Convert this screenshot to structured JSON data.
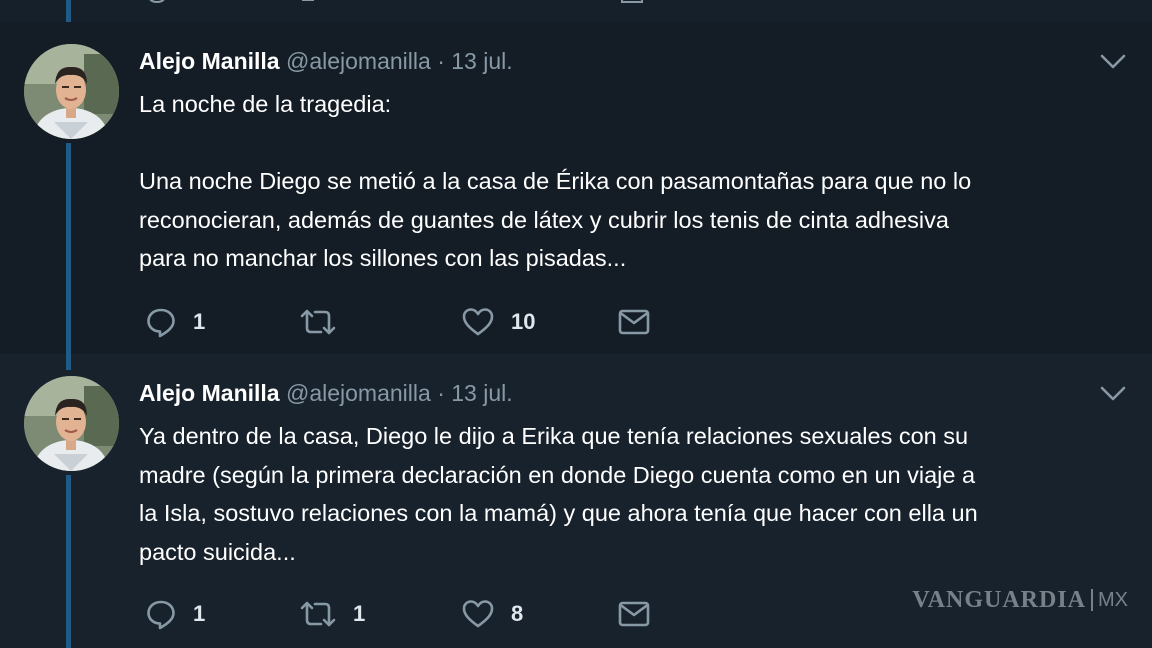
{
  "tweets": [
    {
      "author_name": "Alejo Manilla",
      "author_handle": "@alejomanilla",
      "separator": "·",
      "date": "13 jul.",
      "text_lines": [
        "La noche de la tragedia:",
        "",
        "Una noche Diego se metió a la casa de Érika con pasamontañas para que no lo",
        "reconocieran, además de guantes de látex y cubrir los tenis de cinta adhesiva",
        "para no manchar los sillones con las pisadas..."
      ],
      "reply_count": "1",
      "retweet_count": "",
      "like_count": "10"
    },
    {
      "author_name": "Alejo Manilla",
      "author_handle": "@alejomanilla",
      "separator": "·",
      "date": "13 jul.",
      "text_lines": [
        "Ya dentro de la casa, Diego le dijo a Erika que tenía relaciones sexuales con su",
        "madre (según la primera declaración en donde Diego cuenta como en un viaje a",
        "la Isla, sostuvo relaciones con la mamá) y que ahora tenía que hacer con ella un",
        "pacto suicida..."
      ],
      "reply_count": "1",
      "retweet_count": "1",
      "like_count": "8"
    }
  ],
  "watermark": {
    "brand": "VANGUARDIA",
    "suffix": "MX"
  },
  "icons": {
    "reply": "reply-icon",
    "retweet": "retweet-icon",
    "like": "heart-icon",
    "message": "direct-message-icon",
    "caret": "chevron-down-icon"
  },
  "colors": {
    "background": "#10171e",
    "tweet_background": "#15202b",
    "thread_line": "#1f5b86",
    "secondary_text": "#8899a6",
    "icon": "#8899a6"
  }
}
